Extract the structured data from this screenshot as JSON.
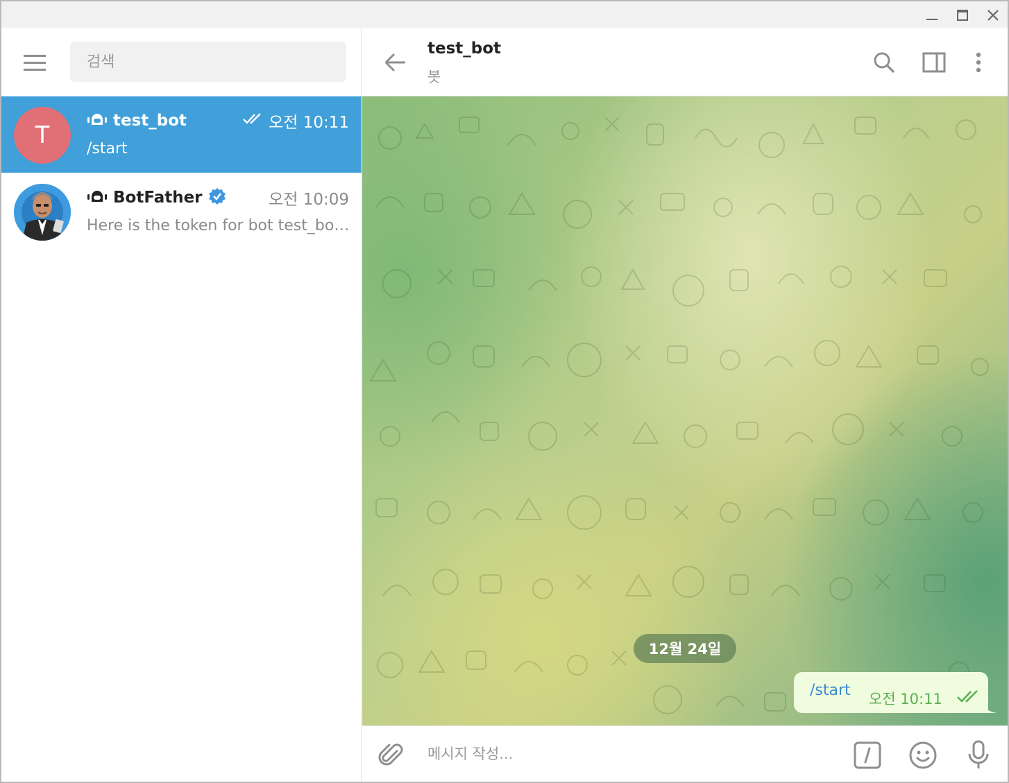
{
  "window": {
    "controls": [
      "minimize-icon",
      "maximize-icon",
      "close-icon"
    ]
  },
  "sidebar": {
    "menu_icon": "hamburger-menu-icon",
    "search_placeholder": "검색",
    "chats": [
      {
        "avatar_letter": "T",
        "avatar_color": "#e17076",
        "name": "test_bot",
        "bot_icon": "bot-icon",
        "time": "오전 10:11",
        "status_icon": "double-check-icon",
        "last_message": "/start",
        "active": true
      },
      {
        "name": "BotFather",
        "bot_icon": "bot-icon",
        "verified_icon": "verified-badge-icon",
        "time": "오전 10:09",
        "last_message": "Here is the token for bot test_bot...",
        "active": false
      }
    ]
  },
  "chat": {
    "title": "test_bot",
    "subtitle": "봇",
    "header_icons": [
      "back-arrow-icon",
      "search-icon",
      "side-panel-icon",
      "more-vertical-icon"
    ],
    "date_separator": "12월 24일",
    "messages": [
      {
        "text": "/start",
        "time": "오전 10:11",
        "outgoing": true,
        "status_icon": "double-check-icon"
      }
    ],
    "composer": {
      "placeholder": "메시지 작성...",
      "icons": [
        "attach-icon",
        "bot-command-icon",
        "emoji-icon",
        "microphone-icon"
      ]
    }
  },
  "colors": {
    "accent": "#419fd9",
    "outgoing_bubble": "#effdde",
    "check_green": "#5fae54"
  }
}
